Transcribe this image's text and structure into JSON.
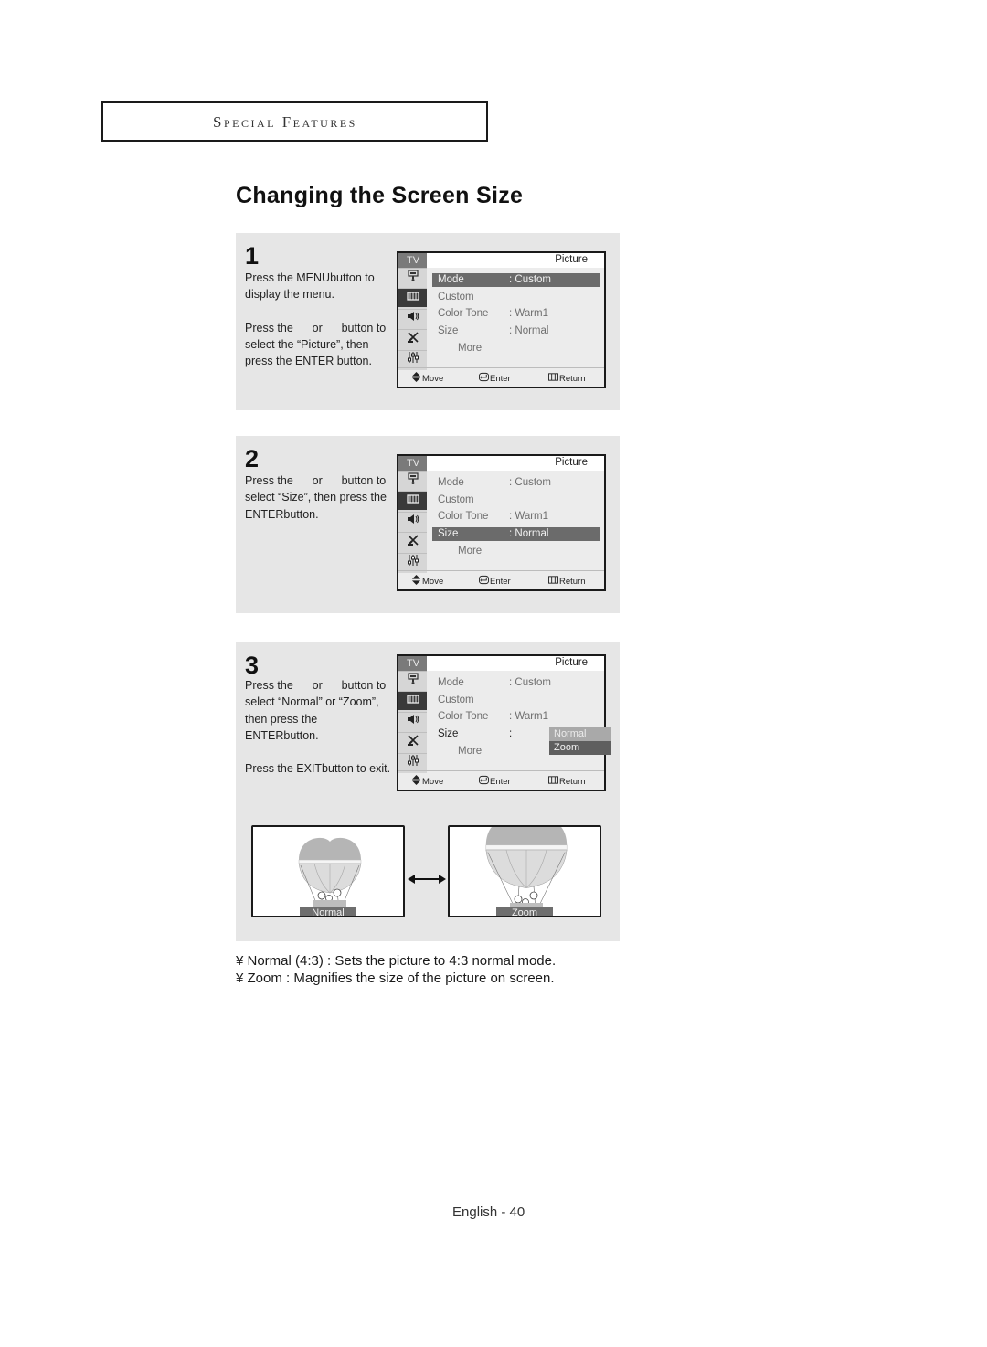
{
  "section_header": "Special Features",
  "page_title": "Changing the Screen Size",
  "osd_common": {
    "tv_tab": "TV",
    "menu_title": "Picture",
    "sidebar_icons": [
      "input-icon",
      "picture-icon",
      "sound-icon",
      "channel-antenna-icon",
      "setup-sliders-icon"
    ],
    "footer": {
      "move": "Move",
      "enter": "Enter",
      "return": "Return"
    }
  },
  "steps": [
    {
      "number": "1",
      "paragraphs": [
        "Press the MENU button to display the menu.",
        "Press the ▲ or ▼ button to select the “Picture”, then press the ENTER button."
      ],
      "paragraphs_display": [
        "Press the MENUbutton to display the menu.",
        "Press the      or      button to select the “Picture”, then press the ENTER button."
      ],
      "menu": {
        "highlighted_row": 0,
        "rows": [
          {
            "label": "Mode",
            "value": ": Custom"
          },
          {
            "label": "Custom",
            "value": ""
          },
          {
            "label": "Color Tone",
            "value": ": Warm1"
          },
          {
            "label": "Size",
            "value": ": Normal"
          },
          {
            "label": "More",
            "value": ""
          }
        ]
      }
    },
    {
      "number": "2",
      "paragraphs_display": [
        "Press the      or      button to select “Size”, then press the ENTERbutton."
      ],
      "menu": {
        "highlighted_row": 3,
        "rows": [
          {
            "label": "Mode",
            "value": ": Custom"
          },
          {
            "label": "Custom",
            "value": ""
          },
          {
            "label": "Color Tone",
            "value": ": Warm1"
          },
          {
            "label": "Size",
            "value": ": Normal"
          },
          {
            "label": "More",
            "value": ""
          }
        ]
      }
    },
    {
      "number": "3",
      "paragraphs_display": [
        "Press the      or      button to select “Normal” or “Zoom”, then press the ENTERbutton.",
        "Press the EXITbutton to exit."
      ],
      "menu": {
        "highlighted_row": -1,
        "rows": [
          {
            "label": "Mode",
            "value": ": Custom"
          },
          {
            "label": "Custom",
            "value": ""
          },
          {
            "label": "Color Tone",
            "value": ": Warm1"
          },
          {
            "label": "Size",
            "value": ":"
          },
          {
            "label": "More",
            "value": ""
          }
        ],
        "dropdown_options": [
          "Normal",
          "Zoom"
        ],
        "dropdown_selected": "Zoom"
      },
      "illustrations": [
        {
          "label": "Normal"
        },
        {
          "label": "Zoom"
        }
      ]
    }
  ],
  "bullets": [
    "¥ Normal (4:3) : Sets the picture to 4:3 normal mode.",
    "¥ Zoom : Magnifies the size of the picture on screen."
  ],
  "footer": "English - 40"
}
